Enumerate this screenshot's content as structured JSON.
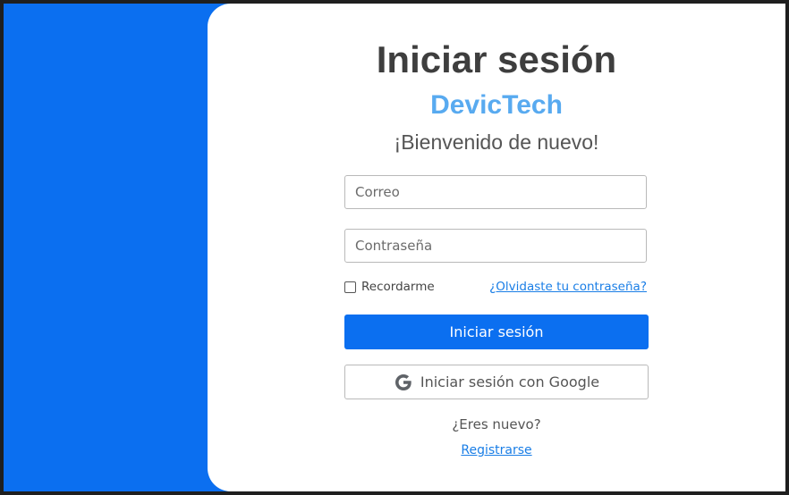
{
  "login": {
    "title": "Iniciar sesión",
    "brand": "DevicTech",
    "welcome": "¡Bienvenido de nuevo!",
    "email_placeholder": "Correo",
    "password_placeholder": "Contraseña",
    "remember_label": "Recordarme",
    "remember_checked": false,
    "forgot_link": "¿Olvidaste tu contraseña?",
    "submit_label": "Iniciar sesión",
    "google_label": "Iniciar sesión con Google",
    "new_user_text": "¿Eres nuevo?",
    "register_link": "Registrarse"
  },
  "colors": {
    "accent": "#0b6ff0",
    "brand": "#58aaf0",
    "link": "#1a7ee6"
  },
  "icons": {
    "google": "google-g-icon"
  }
}
